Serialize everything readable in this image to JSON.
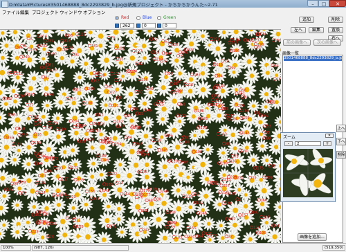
{
  "window": {
    "title": "D:¥data¥Pictures¥3501468888_8dc2293829_b.jpg@新規プロジェクト - かちかちかうんた~2.71",
    "min_glyph": "–",
    "max_glyph": "□",
    "close_glyph": "✕"
  },
  "menu": [
    "ファイル",
    "編集",
    "プロジェクト",
    "ウィンドウ",
    "オプション"
  ],
  "colors": [
    {
      "label": "Red",
      "selected": true,
      "color": "#e02020",
      "count": "262"
    },
    {
      "label": "Blue",
      "selected": false,
      "color": "#2040e0",
      "count": "0"
    },
    {
      "label": "Green",
      "selected": false,
      "color": "#20a020",
      "count": "0"
    }
  ],
  "panel": {
    "add": "追加",
    "delete": "削除",
    "left": "左へ",
    "edit": "編集",
    "replace": "置換",
    "right": "右へ",
    "prev_image": "前の画像へ",
    "next_image": "次の画像へ",
    "image_list_title": "画像一覧",
    "image_list": [
      "3501468888_8dc2293829_b.jpg"
    ],
    "up": "上へ",
    "down": "下へ",
    "remove": "削除",
    "add_image": "画像を追加..."
  },
  "zoom_window": {
    "title": "ズーム",
    "close": "✕",
    "value": "2",
    "minus": "-",
    "plus": "+"
  },
  "status": {
    "zoom": "100%",
    "cursor": "(987, 126)",
    "size": "(519,350)"
  }
}
